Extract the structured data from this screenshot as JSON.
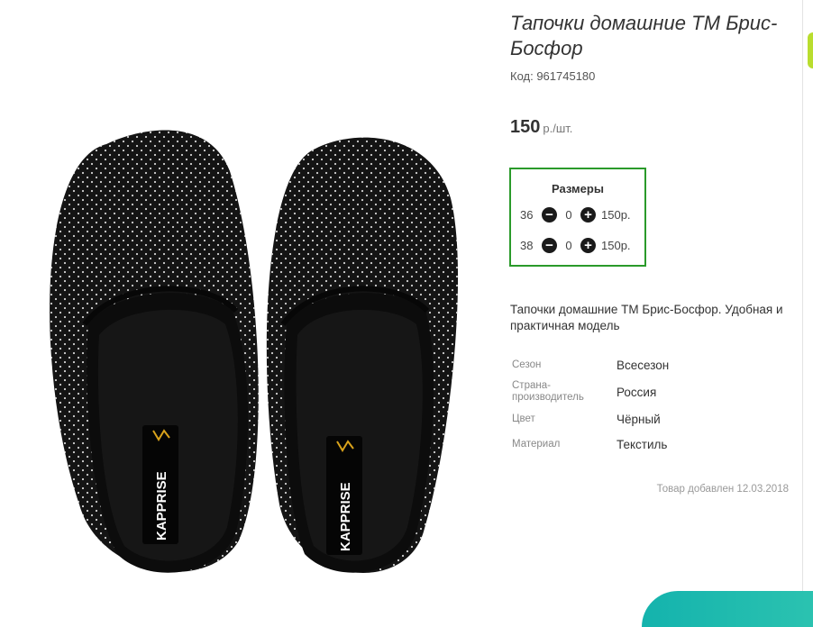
{
  "product": {
    "title": "Тапочки домашние ТМ Брис-Босфор",
    "code": "Код: 961745180",
    "price_amount": "150",
    "price_unit": "р./шт.",
    "image_brand_text": "KAPPRISE",
    "image_icon": "slippers-photo"
  },
  "sizes": {
    "title": "Размеры",
    "rows": [
      {
        "size": "36",
        "qty": "0",
        "price": "150р."
      },
      {
        "size": "38",
        "qty": "0",
        "price": "150р."
      }
    ],
    "minus_icon": "minus-circle-icon",
    "plus_icon": "plus-circle-icon",
    "border_color": "#2a9a2a"
  },
  "description": "Тапочки домашние ТМ Брис-Босфор. Удобная и практичная модель",
  "specs": [
    {
      "label": "Сезон",
      "value": "Всесезон"
    },
    {
      "label": "Страна-производитель",
      "value": "Россия"
    },
    {
      "label": "Цвет",
      "value": "Чёрный"
    },
    {
      "label": "Материал",
      "value": "Текстиль"
    }
  ],
  "added": "Товар добавлен 12.03.2018",
  "colors": {
    "accent_green": "#2a9a2a",
    "side_tab": "#b9dd2e",
    "teal": "#14b3ad"
  }
}
